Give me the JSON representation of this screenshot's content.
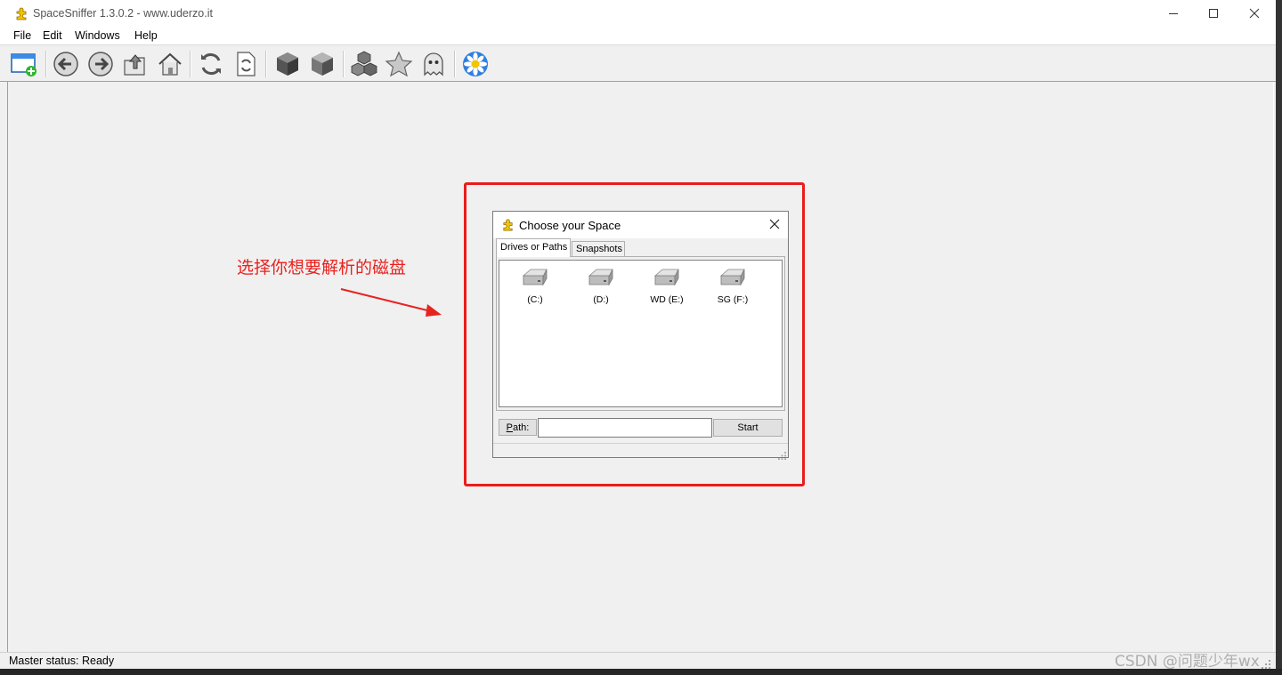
{
  "window": {
    "title": "SpaceSniffer 1.3.0.2 - www.uderzo.it",
    "controls": [
      "minimize",
      "maximize",
      "close"
    ]
  },
  "menu": {
    "items": [
      "File",
      "Edit",
      "Windows",
      "Help"
    ]
  },
  "toolbar": {
    "buttons": [
      {
        "icon": "new-window-icon"
      },
      {
        "icon": "back-arrow-icon"
      },
      {
        "icon": "forward-arrow-icon"
      },
      {
        "icon": "up-folder-icon"
      },
      {
        "icon": "home-icon"
      },
      {
        "icon": "refresh-icon"
      },
      {
        "icon": "refresh-document-icon"
      },
      {
        "icon": "cube-dark-icon"
      },
      {
        "icon": "cube-light-icon"
      },
      {
        "icon": "cubes-icon"
      },
      {
        "icon": "star-icon"
      },
      {
        "icon": "ghost-icon"
      },
      {
        "icon": "flower-icon"
      }
    ]
  },
  "status": {
    "text": "Master status: Ready"
  },
  "annotation": {
    "text": "选择你想要解析的磁盘",
    "color": "#e8231f"
  },
  "dialog": {
    "title": "Choose your Space",
    "tabs": [
      {
        "label": "Drives or Paths",
        "active": true
      },
      {
        "label": "Snapshots",
        "active": false
      }
    ],
    "drives": [
      "(C:)",
      "(D:)",
      "WD (E:)",
      "SG (F:)"
    ],
    "path_label_prefix": "P",
    "path_label_rest": "ath:",
    "path_value": "",
    "start_label": "Start"
  },
  "watermark": {
    "text": "CSDN @问题少年wx"
  }
}
